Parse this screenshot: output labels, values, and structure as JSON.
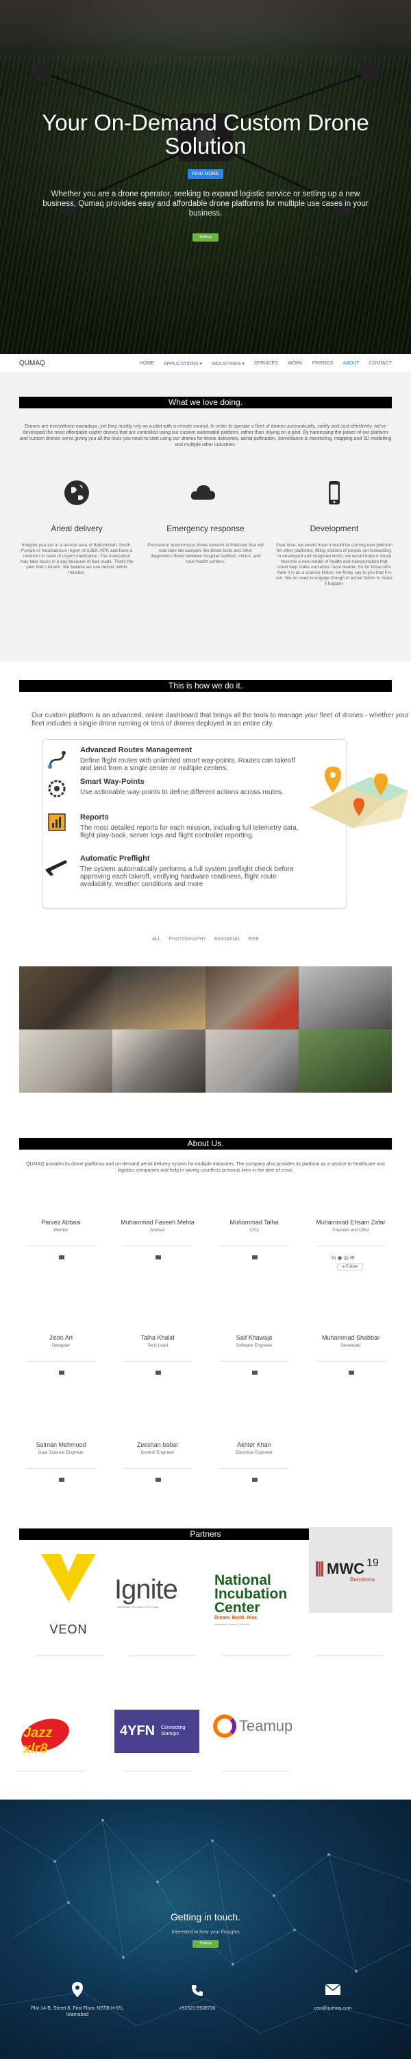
{
  "hero": {
    "title": "Your On-Demand Custom Drone Solution",
    "more_button": "FIND MORE",
    "lead": "Whether you are a drone operator, seeking to expand logistic service or setting up a new business, Qumaq provides easy and affordable drone platforms for multiple use cases in your business.",
    "follow_button": "Follow"
  },
  "nav": {
    "brand": "QUMAQ",
    "items": [
      "HOME",
      "APPLICATIONS ▾",
      "INDUSTRIES ▾",
      "SERVICES",
      "WORK",
      "FRIENDS",
      "ABOUT",
      "CONTACT"
    ],
    "active_index": 6
  },
  "love": {
    "title": "What we love doing.",
    "intro": "Drones are everywhere nowadays, yet they mostly rely on a pilot with a remote control. In order to operate a fleet of drones automatically, safely and cost effectively, we've developed the most affordable copter drones that are controlled using our custom automated platform, rather than relying on a pilot. By harnessing the power of our platform and custom drones we're giving you all the tools you need to start using our drones for drone deliveries, aerial pollination, surveillance & monitoring, mapping and 3D modelling and multiple other industries.",
    "features": [
      {
        "icon": "globe-icon",
        "title": "Arieal delivery",
        "text": "Imagine you are in a remote area of Balochistan, Sindh, Punjab or mountainous region of AJ&K, KPK and have a newborn in need of urgent medication. The medication may take hours in a day because of bad roads. That's the pain that's known. We believe we can deliver within minutes."
      },
      {
        "icon": "cloud-icon",
        "title": "Emergency response",
        "text": "Permanent autonomous drone network in Pakistan that will now take lab samples like blood tests and other diagnostics flown between hospital facilities, clinics, and rural health centers."
      },
      {
        "icon": "mobile-icon",
        "title": "Development",
        "text": "Over time, we would hope it would be coming new platform for other platforms, lifting millions of people out forwarding. In developed and imagined world, we would hope it would become a new model of health and transportation that could help make ourselves more livable. So for those who think it is as a science fiction, we firmly say to you that it is not. We do need to engage though in actual fiction to make it happen."
      }
    ]
  },
  "how": {
    "title": "This is how we do it.",
    "intro": "Our custom platform is an advanced, online dashboard that brings all the tools to manage your fleet of drones - whether your fleet includes a single drone running or tens of drones deployed in an entire city.",
    "items": [
      {
        "icon": "route-icon",
        "title": "Advanced Routes Management",
        "text": "Define flight routes with unlimited smart way-points. Routes can takeoff and land from a single center or multiple centers."
      },
      {
        "icon": "waypoint-icon",
        "title": "Smart Way-Points",
        "text": "Use actionable way-points to define different actions across routes."
      },
      {
        "icon": "reports-icon",
        "title": "Reports",
        "text": "The most detailed reports for each mission, including full telemetry data, flight play-back, server logs and flight controller reporting."
      },
      {
        "icon": "preflight-icon",
        "title": "Automatic Preflight",
        "text": "The system automatically performs a full system preflight check before approving each takeoff, verifying hardware readiness, flight route availability, weather conditions and more"
      }
    ]
  },
  "filters": {
    "items": [
      "ALL",
      "PHOTOGRAPHY",
      "BRANDING",
      "WEB"
    ],
    "active_index": 0
  },
  "about": {
    "title": "About Us.",
    "intro": "QUMAQ provides its drone platforms and on-demand aerial delivery system for multiple industries. The company also provides its platform as a service to healthcare and logistics companies and help in saving countless precious lives in the time of crisis.",
    "team": [
      {
        "name": "Parvez Abbasi",
        "role": "Mentor"
      },
      {
        "name": "Muhammad Faseeh Mehta",
        "role": "Advisor"
      },
      {
        "name": "Muhammad Talha",
        "role": "CTO"
      },
      {
        "name": "Muhammad Ehsam Zafar",
        "role": "Founder and CEO"
      },
      {
        "name": "Jison Art",
        "role": "Designer"
      },
      {
        "name": "Talha Khalid",
        "role": "Tech Lead"
      },
      {
        "name": "Saif Khawaja",
        "role": "Software Engineer"
      },
      {
        "name": "Muhammad Shabbar",
        "role": "Developer"
      },
      {
        "name": "Salman Mehmood",
        "role": "Data Science Engineer"
      },
      {
        "name": "Zeeshan babar",
        "role": "Control Engineer"
      },
      {
        "name": "Akhter Khan",
        "role": "Electrical Engineer"
      }
    ],
    "ceo_follow": "Follow"
  },
  "partners": {
    "title": "Partners",
    "logos": [
      {
        "name": "VEON"
      },
      {
        "name": "Ignite",
        "tagline": "NATIONAL TECHNOLOGY FUND"
      },
      {
        "name1": "National",
        "name2": "Incubation",
        "name3": "Center",
        "tagline": "Dream. Build. Rise.",
        "sub": "Islamabad | Lahore | Karachi"
      },
      {
        "name": "MWC",
        "year": "19",
        "city": "Barcelona"
      },
      {
        "name": "Jazz xlr8"
      },
      {
        "name": "4YFN",
        "tagline": "Connecting Startups"
      },
      {
        "name": "Teamup"
      }
    ]
  },
  "footer": {
    "title": "Getting in touch.",
    "sub": "Interested to hear your thoughts",
    "follow": "Follow",
    "address": "Plot 14-B, Street 8, First Floor, NSTB H-9/1, Islamabad",
    "phone": "+92321-9538730",
    "email": "ceo@qumaq.com"
  }
}
